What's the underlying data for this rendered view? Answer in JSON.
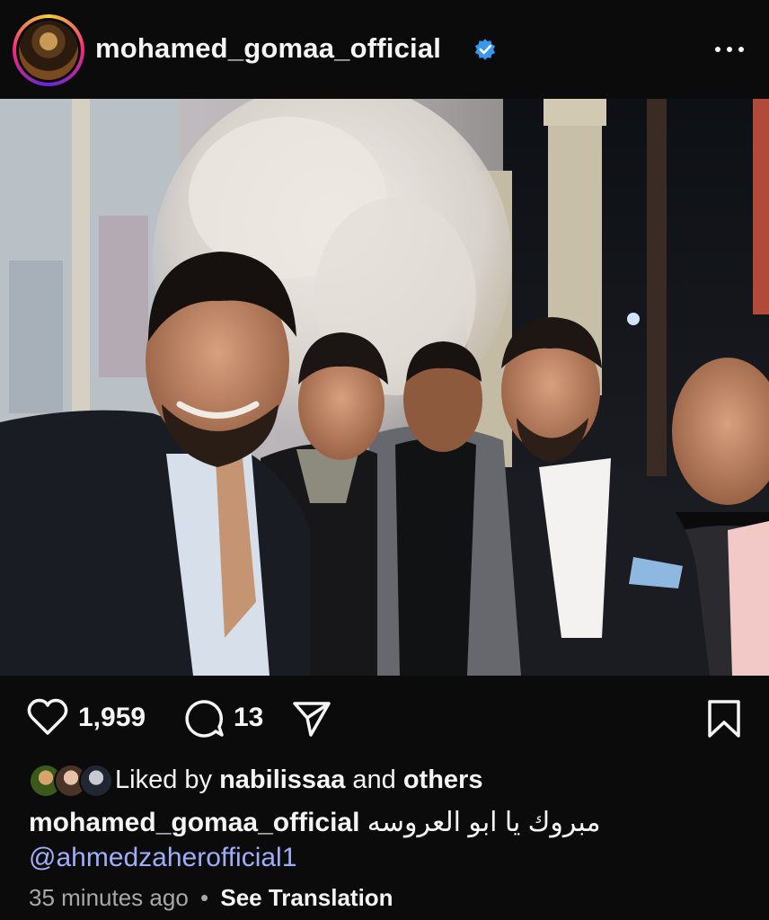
{
  "header": {
    "username": "mohamed_gomaa_official",
    "verified_icon": "verified-badge-icon",
    "more_icon": "more-options-icon"
  },
  "actions": {
    "like_icon": "heart-icon",
    "likes_count": "1,959",
    "comment_icon": "comment-bubble-icon",
    "comments_count": "13",
    "share_icon": "send-paper-plane-icon",
    "save_icon": "bookmark-icon"
  },
  "liked_by": {
    "prefix": "Liked by",
    "user": "nabilissaa",
    "joiner": "and",
    "others": "others"
  },
  "caption": {
    "username": "mohamed_gomaa_official",
    "text": "مبروك يا ابو العروسه",
    "mention": "@ahmedzaherofficial1"
  },
  "meta": {
    "time": "35 minutes ago",
    "separator": "•",
    "see_translation": "See Translation"
  },
  "colors": {
    "background": "#0b0b0c",
    "text": "#f5f5f5",
    "mention": "#9eaef8",
    "verified": "#3897f0",
    "muted": "#a8a8a8"
  }
}
